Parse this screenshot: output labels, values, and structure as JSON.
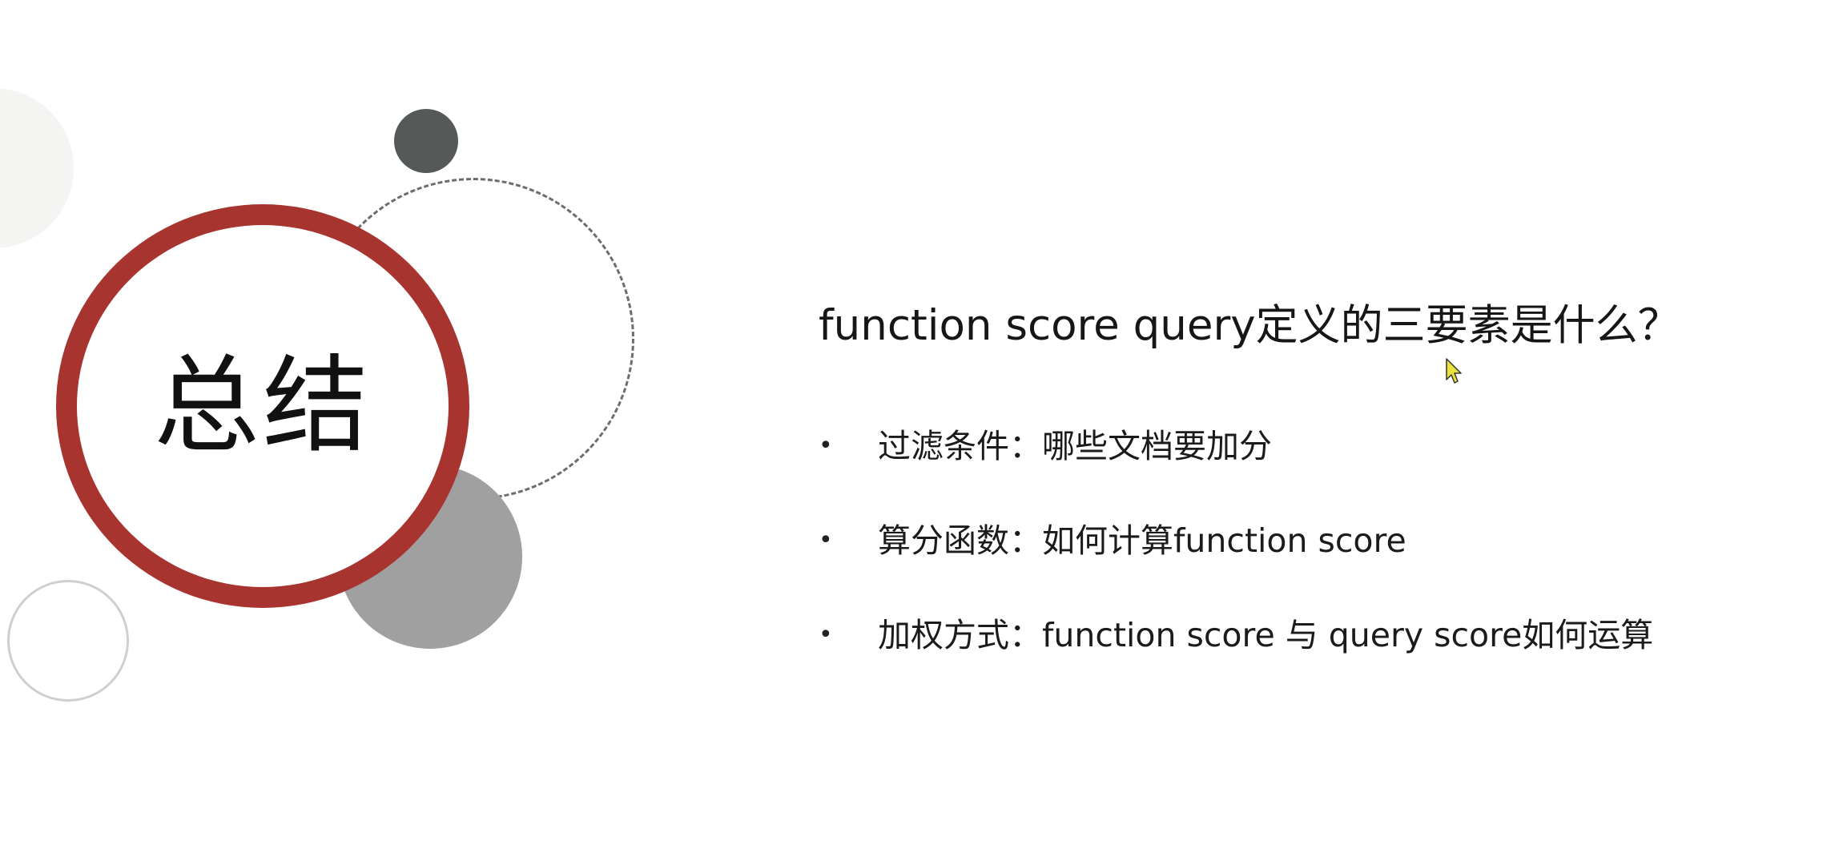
{
  "slide": {
    "title": "总结",
    "question": "function score query定义的三要素是什么？",
    "bullets": [
      {
        "symbol": "•",
        "text": "过滤条件：哪些文档要加分"
      },
      {
        "symbol": "•",
        "text": "算分函数：如何计算function  score"
      },
      {
        "symbol": "•",
        "text": "加权方式：function score 与 query score如何运算"
      }
    ]
  },
  "colors": {
    "accent_ring": "#a83430",
    "dark_circle": "#555958",
    "gray_circle": "#a0a0a0",
    "cursor": "#e8e23a"
  },
  "icons": {
    "cursor": "mouse-pointer-icon"
  }
}
